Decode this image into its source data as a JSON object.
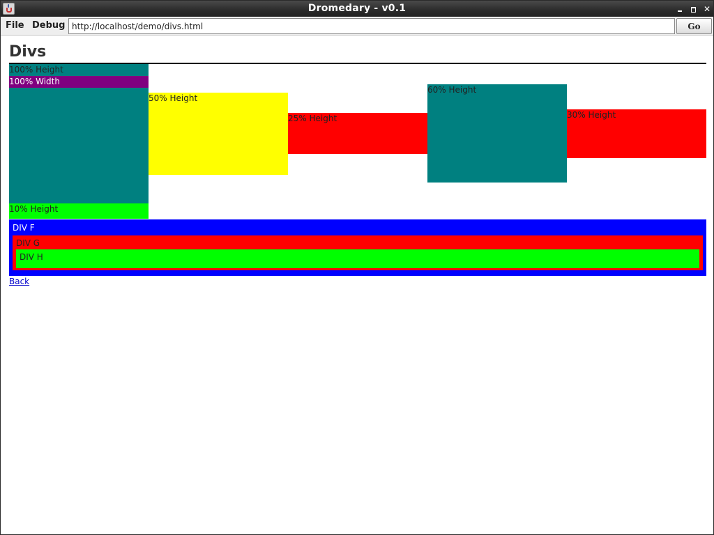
{
  "window": {
    "title": "Dromedary - v0.1"
  },
  "menu": {
    "file": "File",
    "debug": "Debug"
  },
  "address": {
    "url": "http://localhost/demo/divs.html",
    "go_label": "Go"
  },
  "page": {
    "title": "Divs",
    "boxes": {
      "full_height": "100% Height",
      "full_width": "100% Width",
      "ten_height": "10% Height",
      "fifty_height": "50% Height",
      "twentyfive_height": "25% Height",
      "sixty_height": "60% Height",
      "thirty_height": "30% Height"
    },
    "nested": {
      "f": "DIV F",
      "g": "DIV G",
      "h": "DIV H"
    },
    "back_link": "Back"
  },
  "colors": {
    "teal": "#008080",
    "purple": "#800080",
    "lime": "#00ff00",
    "yellow": "#ffff00",
    "red": "#ff0000",
    "blue": "#0000ff"
  }
}
